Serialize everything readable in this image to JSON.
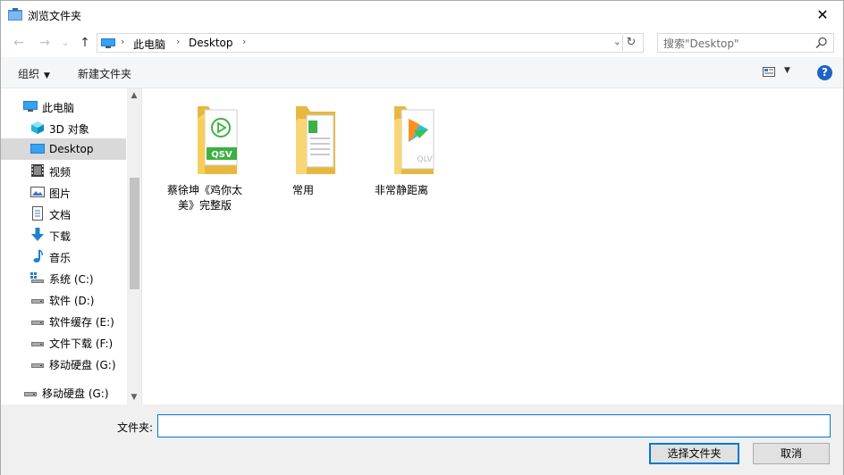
{
  "window": {
    "title": "浏览文件夹",
    "close_glyph": "✕"
  },
  "nav": {
    "back_glyph": "←",
    "forward_glyph": "→",
    "recent_glyph": "⌄",
    "up_glyph": "↑",
    "breadcrumbs": [
      "此电脑",
      "Desktop"
    ],
    "separator_glyph": "›",
    "dropdown_glyph": "⌄",
    "refresh_glyph": "↻"
  },
  "search": {
    "placeholder": "搜索\"Desktop\""
  },
  "toolbar": {
    "organize_label": "组织",
    "organize_caret": "▼",
    "new_folder_label": "新建文件夹",
    "view_caret": "▼",
    "help_glyph": "?"
  },
  "sidebar": {
    "items": [
      {
        "label": "此电脑",
        "icon": "computer-icon"
      },
      {
        "label": "3D 对象",
        "icon": "3d-objects-icon"
      },
      {
        "label": "Desktop",
        "icon": "desktop-icon",
        "selected": true
      },
      {
        "label": "视频",
        "icon": "video-icon"
      },
      {
        "label": "图片",
        "icon": "pictures-icon"
      },
      {
        "label": "文档",
        "icon": "documents-icon"
      },
      {
        "label": "下载",
        "icon": "downloads-icon"
      },
      {
        "label": "音乐",
        "icon": "music-icon"
      },
      {
        "label": "系统 (C:)",
        "icon": "system-drive-icon"
      },
      {
        "label": "软件 (D:)",
        "icon": "drive-icon"
      },
      {
        "label": "软件缓存 (E:)",
        "icon": "drive-icon"
      },
      {
        "label": "文件下载 (F:)",
        "icon": "drive-icon"
      },
      {
        "label": "移动硬盘 (G:)",
        "icon": "drive-icon"
      },
      {
        "label": "移动硬盘 (G:)",
        "icon": "drive-icon"
      }
    ],
    "scroll_up_glyph": "▲",
    "scroll_down_glyph": "▼"
  },
  "content": {
    "items": [
      {
        "line1": "蔡徐坤《鸡你太",
        "line2": "美》完整版",
        "icon": "folder-qsv-icon",
        "badge": "QSV"
      },
      {
        "line1": "常用",
        "line2": "",
        "icon": "folder-documents-icon"
      },
      {
        "line1": "非常静距离",
        "line2": "",
        "icon": "folder-qlv-icon",
        "badge": "QLV"
      }
    ]
  },
  "footer": {
    "folder_label": "文件夹:",
    "folder_value": "",
    "select_button": "选择文件夹",
    "cancel_button": "取消"
  },
  "colors": {
    "accent": "#0078d7",
    "folder": "#f8d675",
    "folder_dark": "#e8b83e",
    "help": "#1e63c6"
  }
}
